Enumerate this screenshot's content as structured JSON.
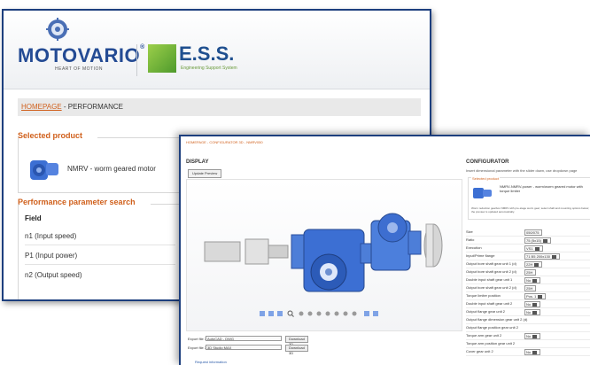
{
  "back_window": {
    "brand": "MOTOVARIO",
    "brand_mark": "®",
    "tagline": "HEART OF MOTION",
    "partner": "E.S.S.",
    "partner_sub": "Engineering Support System",
    "breadcrumb": {
      "home": "HOMEPAGE",
      "sep": " - ",
      "current": "PERFORMANCE"
    },
    "selected_product": {
      "title": "Selected product",
      "name": "NMRV - worm geared motor"
    },
    "parameter_search": {
      "title": "Performance parameter search",
      "field_header": "Field",
      "params": [
        "n1 (Input speed)",
        "P1 (Input power)",
        "n2 (Output speed)"
      ]
    }
  },
  "front_window": {
    "breadcrumb": "HOMEPAGE - CONFIGURATOR 3D - NMRV050",
    "display": {
      "title": "DISPLAY",
      "update_button": "Update Preview"
    },
    "configurator": {
      "title": "CONFIGURATOR",
      "intro": "Insert dimensional parameter with the slider down, use dropdown page",
      "product_box_title": "Selected product",
      "product_name": "NMRV-NMRV-power - worm/worm geared motor with torque limiter",
      "note": "Worm reduction gearbox NMRV with pre-stage worm gear; select shaft and mounting options below; the preview is updated automatically.",
      "rows": [
        {
          "label": "Size",
          "value": "050/075"
        },
        {
          "label": "Ratio",
          "value": "75 (5x15)"
        },
        {
          "label": "Execution",
          "value": "VS1"
        },
        {
          "label": "Input/Prime flange",
          "value": "71 B5 200x130"
        },
        {
          "label": "Output bore shaft gear unit 1 (d)",
          "value": "22H"
        },
        {
          "label": "Output bore shaft gear unit 2 (d)",
          "value": "25H"
        },
        {
          "label": "Double input shaft gear unit 1",
          "value": "No"
        },
        {
          "label": "Output bore shaft gear unit 2 (d)",
          "value": "25H"
        },
        {
          "label": "Torque limiter position",
          "value": "Pos. 1"
        },
        {
          "label": "Double input shaft gear unit 2",
          "value": "No"
        },
        {
          "label": "Output flange gear unit 2",
          "value": "No"
        },
        {
          "label": "Output flange dimension gear unit 2 (d)",
          "value": ""
        },
        {
          "label": "Output flange position gear unit 2",
          "value": ""
        },
        {
          "label": "Torque arm gear unit 2",
          "value": "No"
        },
        {
          "label": "Torque arm position gear unit 2",
          "value": ""
        },
        {
          "label": "Cover gear unit 2",
          "value": "No"
        }
      ]
    },
    "exports": [
      {
        "label": "Export file 3D",
        "format": "AutoCAD - DWG",
        "button": "Download 3D"
      },
      {
        "label": "Export file 3D",
        "format": "3D Studio MAX",
        "button": "Download 3D"
      }
    ],
    "bottom_link": "Request information",
    "watermark_hint": "ESS"
  },
  "colors": {
    "frame": "#1d3f7e",
    "accent": "#d0601c",
    "brand": "#244b94",
    "motor_blue": "#3c6fd3"
  }
}
